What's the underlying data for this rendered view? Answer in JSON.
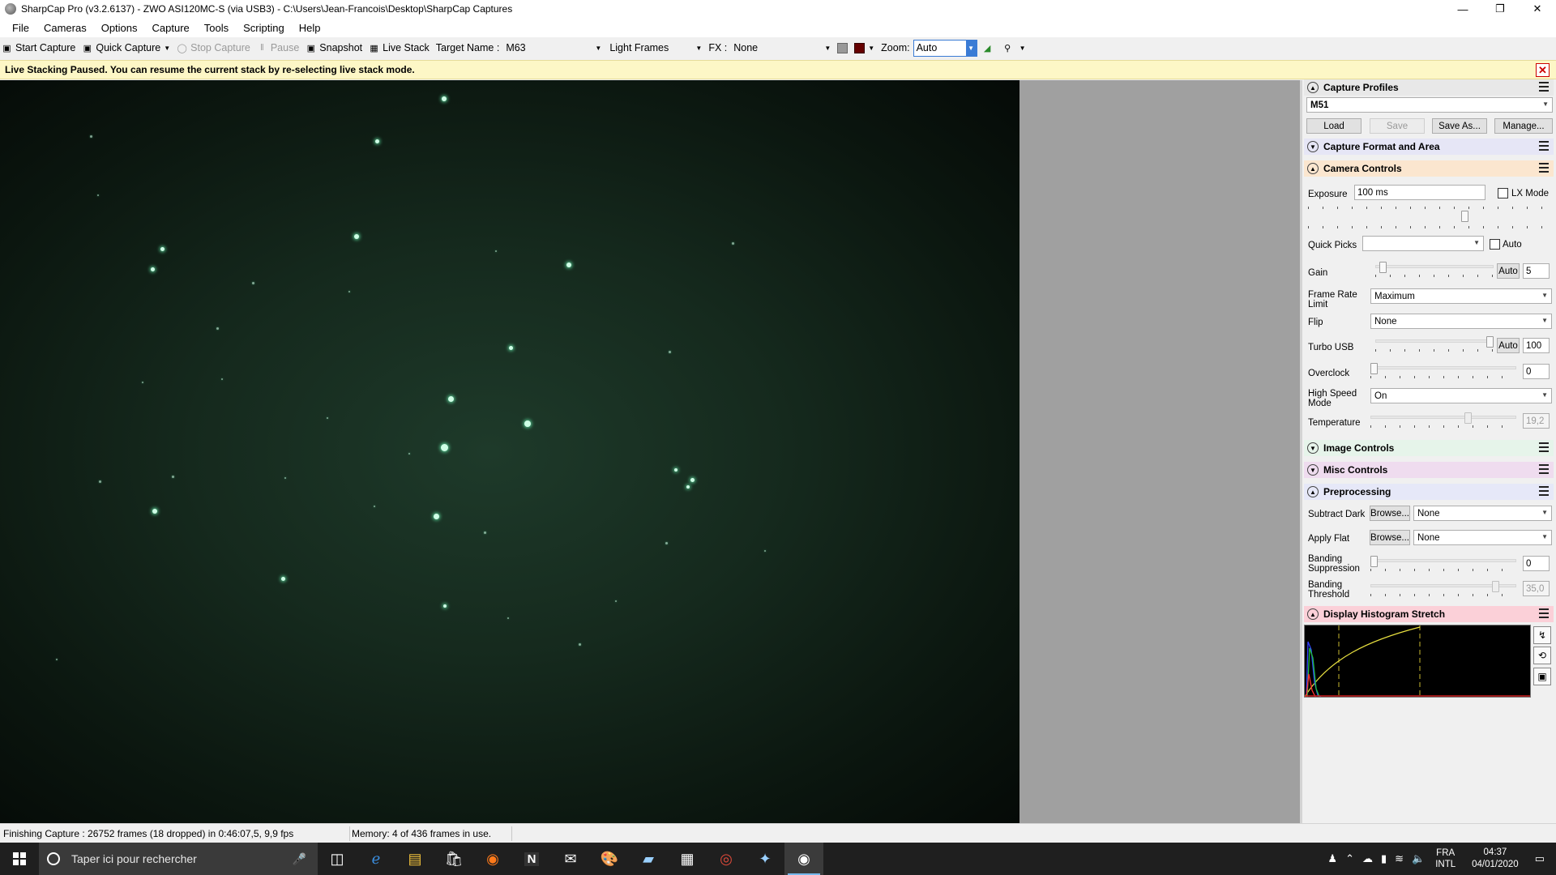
{
  "window": {
    "title": "SharpCap Pro (v3.2.6137) - ZWO ASI120MC-S (via USB3) - C:\\Users\\Jean-Francois\\Desktop\\SharpCap Captures",
    "minimize": "—",
    "maximize": "❐",
    "close": "✕"
  },
  "menu": [
    "File",
    "Cameras",
    "Options",
    "Capture",
    "Tools",
    "Scripting",
    "Help"
  ],
  "toolbar": {
    "start_capture": "Start Capture",
    "quick_capture": "Quick Capture",
    "stop_capture": "Stop Capture",
    "pause": "Pause",
    "snapshot": "Snapshot",
    "live_stack": "Live Stack",
    "target_label": "Target Name :",
    "target_value": "M63",
    "frame_type": "Light Frames",
    "fx_label": "FX :",
    "fx_value": "None",
    "zoom_label": "Zoom:",
    "zoom_value": "Auto"
  },
  "notice": {
    "text": "Live Stacking Paused. You can resume the current stack by re-selecting live stack mode.",
    "close": "✕"
  },
  "panel": {
    "capture_profiles": {
      "title": "Capture Profiles",
      "profile": "M51",
      "load": "Load",
      "save": "Save",
      "save_as": "Save As...",
      "manage": "Manage..."
    },
    "capture_format": {
      "title": "Capture Format and Area"
    },
    "camera_controls": {
      "title": "Camera Controls",
      "exposure_label": "Exposure",
      "exposure_value": "100 ms",
      "lx_mode": "LX Mode",
      "quick_picks": "Quick Picks",
      "auto": "Auto",
      "gain_label": "Gain",
      "gain_auto": "Auto",
      "gain_value": "5",
      "frame_rate_label": "Frame Rate Limit",
      "frame_rate_value": "Maximum",
      "flip_label": "Flip",
      "flip_value": "None",
      "turbo_label": "Turbo USB",
      "turbo_auto": "Auto",
      "turbo_value": "100",
      "overclock_label": "Overclock",
      "overclock_value": "0",
      "highspeed_label": "High Speed Mode",
      "highspeed_value": "On",
      "temperature_label": "Temperature",
      "temperature_value": "19,2",
      "exposure_level": 0.65,
      "gain_level": 0.04,
      "turbo_level": 1.0,
      "overclock_level": 0.0,
      "temperature_level": 0.68
    },
    "image_controls": {
      "title": "Image Controls"
    },
    "misc_controls": {
      "title": "Misc Controls"
    },
    "preprocessing": {
      "title": "Preprocessing",
      "subtract_dark_label": "Subtract Dark",
      "apply_flat_label": "Apply Flat",
      "browse": "Browse...",
      "dark_value": "None",
      "flat_value": "None",
      "banding_suppression_label": "Banding Suppression",
      "banding_suppression_value": "0",
      "banding_threshold_label": "Banding Threshold",
      "banding_threshold_value": "35,0",
      "banding_suppression_level": 0.0,
      "banding_threshold_level": 0.88
    },
    "histogram": {
      "title": "Display Histogram Stretch"
    }
  },
  "status": {
    "capture": "Finishing Capture : 26752 frames (18 dropped) in 0:46:07,5, 9,9 fps",
    "memory": "Memory: 4 of 436 frames in use."
  },
  "taskbar": {
    "search_placeholder": "Taper ici pour rechercher",
    "lang_top": "FRA",
    "lang_bottom": "INTL",
    "time": "04:37",
    "date": "04/01/2020"
  },
  "colors": {
    "accent": "#3a7bd5",
    "notice_bg": "#fdf7c6",
    "camera_header": "#fbe6cf",
    "histogram_header": "#fbd0d8"
  }
}
